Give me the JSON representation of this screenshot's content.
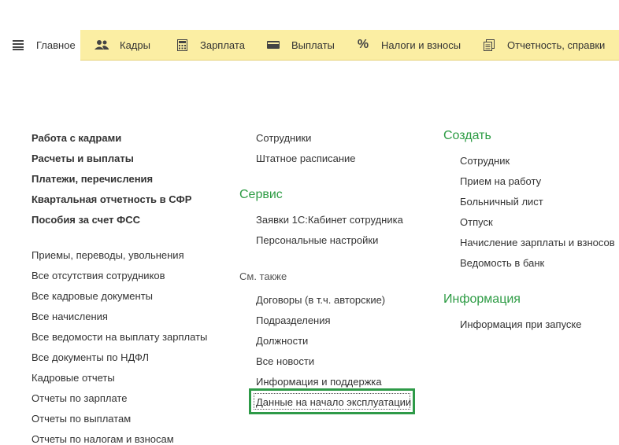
{
  "tabs": [
    {
      "label": "Главное",
      "icon": "menu-icon",
      "active": true
    },
    {
      "label": "Кадры",
      "icon": "people-icon"
    },
    {
      "label": "Зарплата",
      "icon": "calculator-icon"
    },
    {
      "label": "Выплаты",
      "icon": "wallet-icon"
    },
    {
      "label": "Налоги и взносы",
      "icon": "percent-icon"
    },
    {
      "label": "Отчетность, справки",
      "icon": "reports-icon"
    }
  ],
  "left": {
    "bold_items": [
      "Работа с кадрами",
      "Расчеты и выплаты",
      "Платежи, перечисления",
      "Квартальная отчетность в СФР",
      "Пособия за счет ФСС"
    ],
    "items": [
      "Приемы, переводы, увольнения",
      "Все отсутствия сотрудников",
      "Все кадровые документы",
      "Все начисления",
      "Все ведомости на выплату зарплаты",
      "Все документы по НДФЛ",
      "Кадровые отчеты",
      "Отчеты по зарплате",
      "Отчеты по выплатам",
      "Отчеты по налогам и взносам"
    ]
  },
  "middle": {
    "top_items": [
      "Сотрудники",
      "Штатное расписание"
    ],
    "service_header": "Сервис",
    "service_items": [
      "Заявки 1С:Кабинет сотрудника",
      "Персональные настройки"
    ],
    "see_also_header": "См. также",
    "see_also_items": [
      "Договоры (в т.ч. авторские)",
      "Подразделения",
      "Должности",
      "Все новости",
      "Информация и поддержка",
      "Данные на начало эксплуатации"
    ]
  },
  "right": {
    "create_header": "Создать",
    "create_items": [
      "Сотрудник",
      "Прием на работу",
      "Больничный лист",
      "Отпуск",
      "Начисление зарплаты и взносов",
      "Ведомость в банк"
    ],
    "info_header": "Информация",
    "info_items": [
      "Информация при запуске"
    ]
  },
  "colors": {
    "accent_green": "#2c9b43",
    "tabbar": "#fbeea3",
    "highlight": "#2e9a48"
  }
}
